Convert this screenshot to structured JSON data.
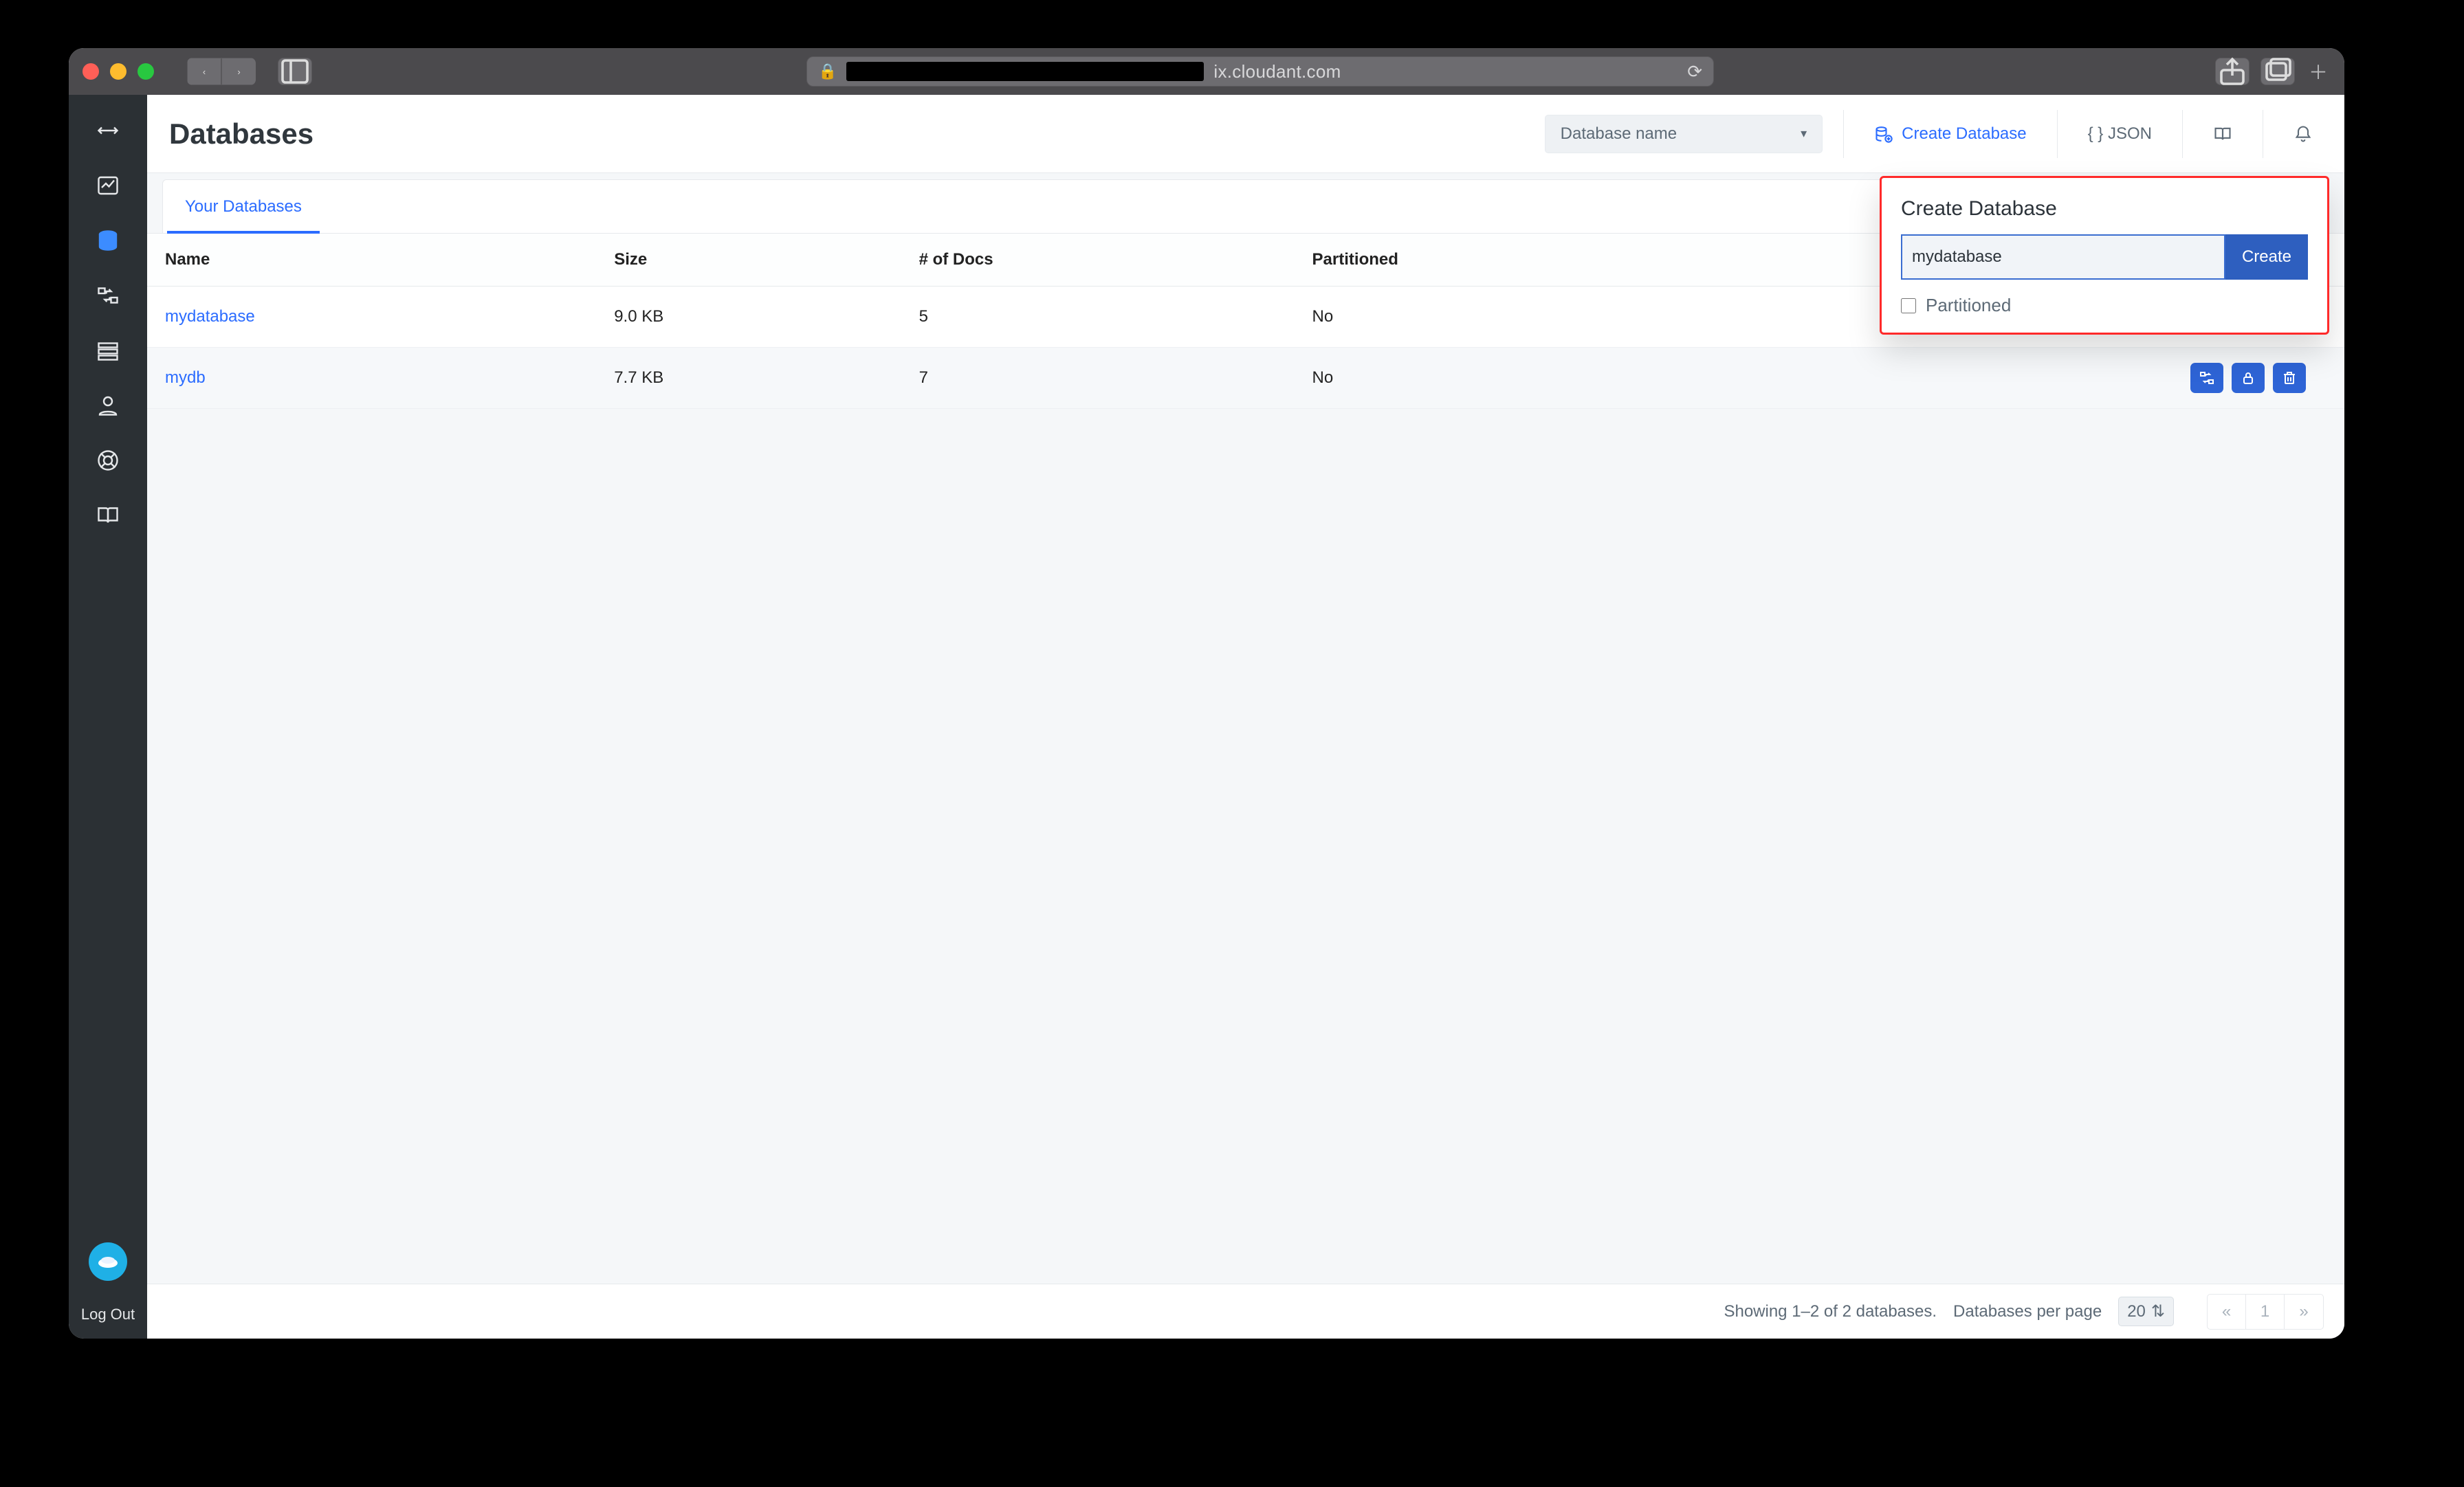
{
  "browser": {
    "domain": "ix.cloudant.com"
  },
  "sidebar": {
    "logout": "Log Out"
  },
  "header": {
    "title": "Databases",
    "db_select_label": "Database name",
    "create_db": "Create Database",
    "json": "{ } JSON"
  },
  "tabs": [
    {
      "label": "Your Databases",
      "active": true
    }
  ],
  "table": {
    "columns": [
      "Name",
      "Size",
      "# of Docs",
      "Partitioned"
    ],
    "rows": [
      {
        "name": "mydatabase",
        "size": "9.0 KB",
        "docs": "5",
        "partitioned": "No"
      },
      {
        "name": "mydb",
        "size": "7.7 KB",
        "docs": "7",
        "partitioned": "No"
      }
    ]
  },
  "popover": {
    "title": "Create Database",
    "input_value": "mydatabase",
    "create_label": "Create",
    "partitioned_label": "Partitioned"
  },
  "footer": {
    "showing": "Showing 1–2 of 2 databases.",
    "per_page_label": "Databases per page",
    "per_page_value": "20",
    "current_page": "1"
  },
  "row_actions": [
    "replicate",
    "permissions",
    "delete"
  ]
}
